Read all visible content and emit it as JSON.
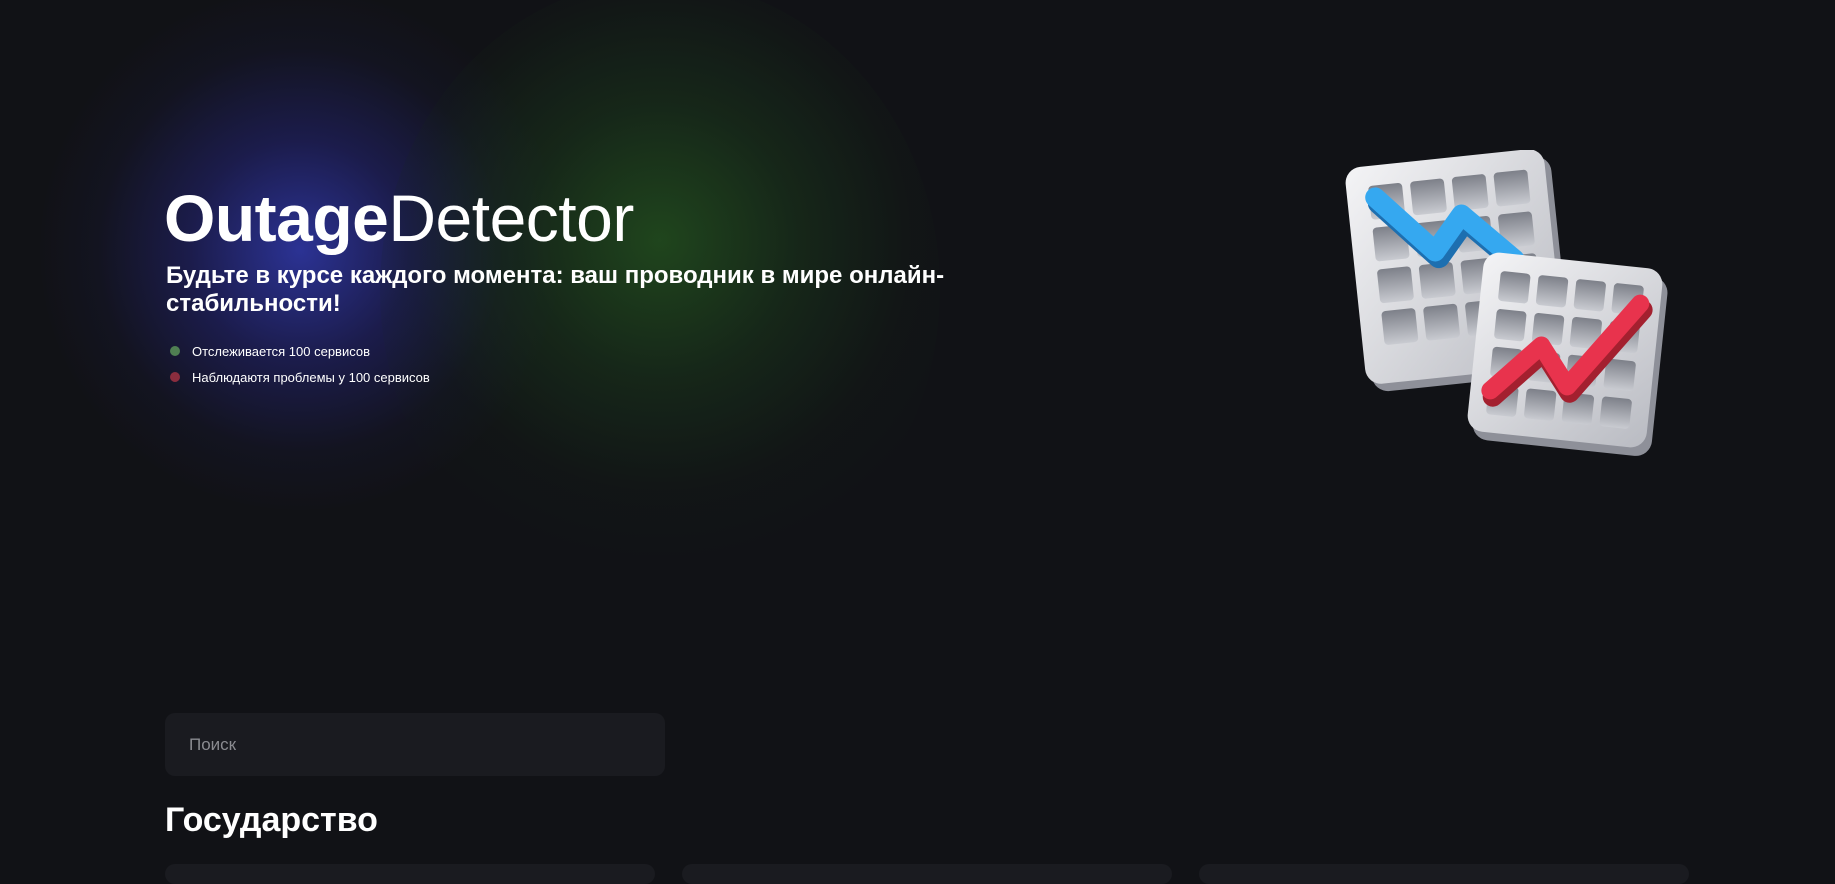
{
  "hero": {
    "brand_bold": "Outage",
    "brand_light": "Detector",
    "tagline": "Будьте в курсе каждого момента: ваш проводник в мире онлайн-стабильности!",
    "stats": [
      {
        "text": "Отслеживается 100 сервисов",
        "color": "#4f7f52"
      },
      {
        "text": "Наблюдаютя проблемы у 100 сервисов",
        "color": "#8a2d3e"
      }
    ]
  },
  "search": {
    "placeholder": "Поиск"
  },
  "section": {
    "title": "Государство"
  },
  "colors": {
    "background": "#111216",
    "chart_blue": "#35a8f0",
    "chart_red": "#e8334d"
  },
  "icons": {
    "illustration": "outage-charts-illustration"
  }
}
